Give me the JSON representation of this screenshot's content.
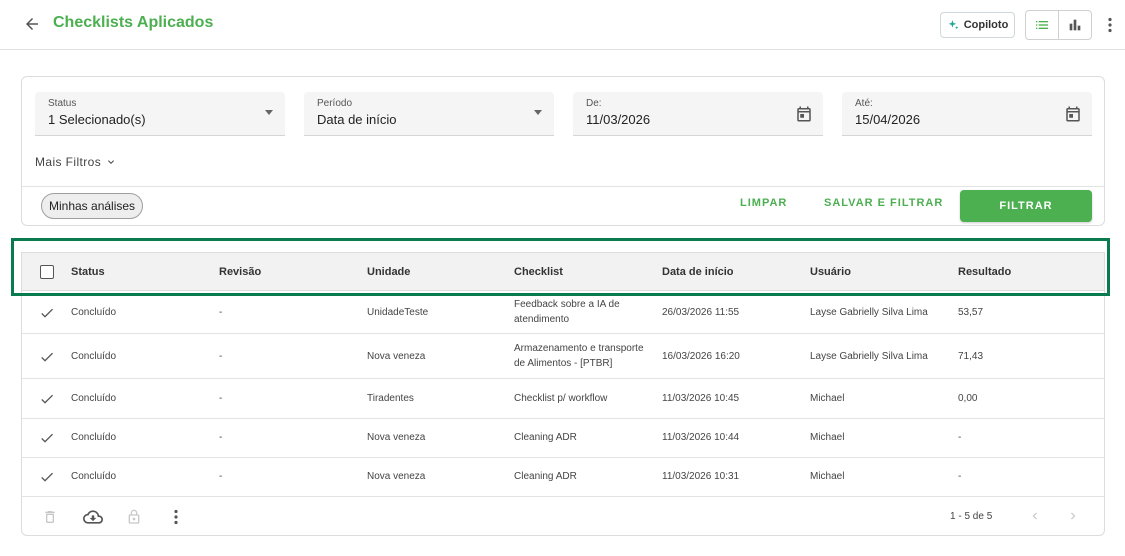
{
  "header": {
    "title": "Checklists Aplicados",
    "copilot_label": "Copiloto"
  },
  "filters": {
    "status": {
      "label": "Status",
      "value": "1 Selecionado(s)"
    },
    "period": {
      "label": "Período",
      "value": "Data de início"
    },
    "from": {
      "label": "De:",
      "value": "11/03/2026"
    },
    "to": {
      "label": "Até:",
      "value": "15/04/2026"
    },
    "more_filters": "Mais Filtros",
    "chip": "Minhas análises",
    "clear": "LIMPAR",
    "save_filter": "SALVAR E FILTRAR",
    "apply": "FILTRAR"
  },
  "table": {
    "columns": [
      "Status",
      "Revisão",
      "Unidade",
      "Checklist",
      "Data de início",
      "Usuário",
      "Resultado"
    ],
    "rows": [
      {
        "status": "Concluído",
        "revision": "-",
        "unit": "UnidadeTeste",
        "checklist": "Feedback sobre a IA de atendimento",
        "start": "26/03/2026 11:55",
        "user": "Layse Gabrielly Silva Lima",
        "result": "53,57"
      },
      {
        "status": "Concluído",
        "revision": "-",
        "unit": "Nova veneza",
        "checklist": "Armazenamento e transporte de Alimentos - [PTBR]",
        "start": "16/03/2026 16:20",
        "user": "Layse Gabrielly Silva Lima",
        "result": "71,43"
      },
      {
        "status": "Concluído",
        "revision": "-",
        "unit": "Tiradentes",
        "checklist": "Checklist p/ workflow",
        "start": "11/03/2026 10:45",
        "user": "Michael",
        "result": "0,00"
      },
      {
        "status": "Concluído",
        "revision": "-",
        "unit": "Nova veneza",
        "checklist": "Cleaning ADR",
        "start": "11/03/2026 10:44",
        "user": "Michael",
        "result": "-"
      },
      {
        "status": "Concluído",
        "revision": "-",
        "unit": "Nova veneza",
        "checklist": "Cleaning ADR",
        "start": "11/03/2026 10:31",
        "user": "Michael",
        "result": "-"
      }
    ],
    "pagination": "1 - 5 de 5"
  },
  "colors": {
    "brand": "#4caf50",
    "highlight": "#0a7a4f"
  },
  "icons": {
    "back": "arrow-left-icon",
    "copilot": "sparkle-icon",
    "list_view": "list-icon",
    "chart_view": "bar-chart-icon",
    "menu": "more-vert-icon",
    "calendar": "calendar-icon",
    "row_status": "check-icon",
    "delete": "trash-icon",
    "download": "cloud-download-icon",
    "lock": "lock-icon"
  }
}
